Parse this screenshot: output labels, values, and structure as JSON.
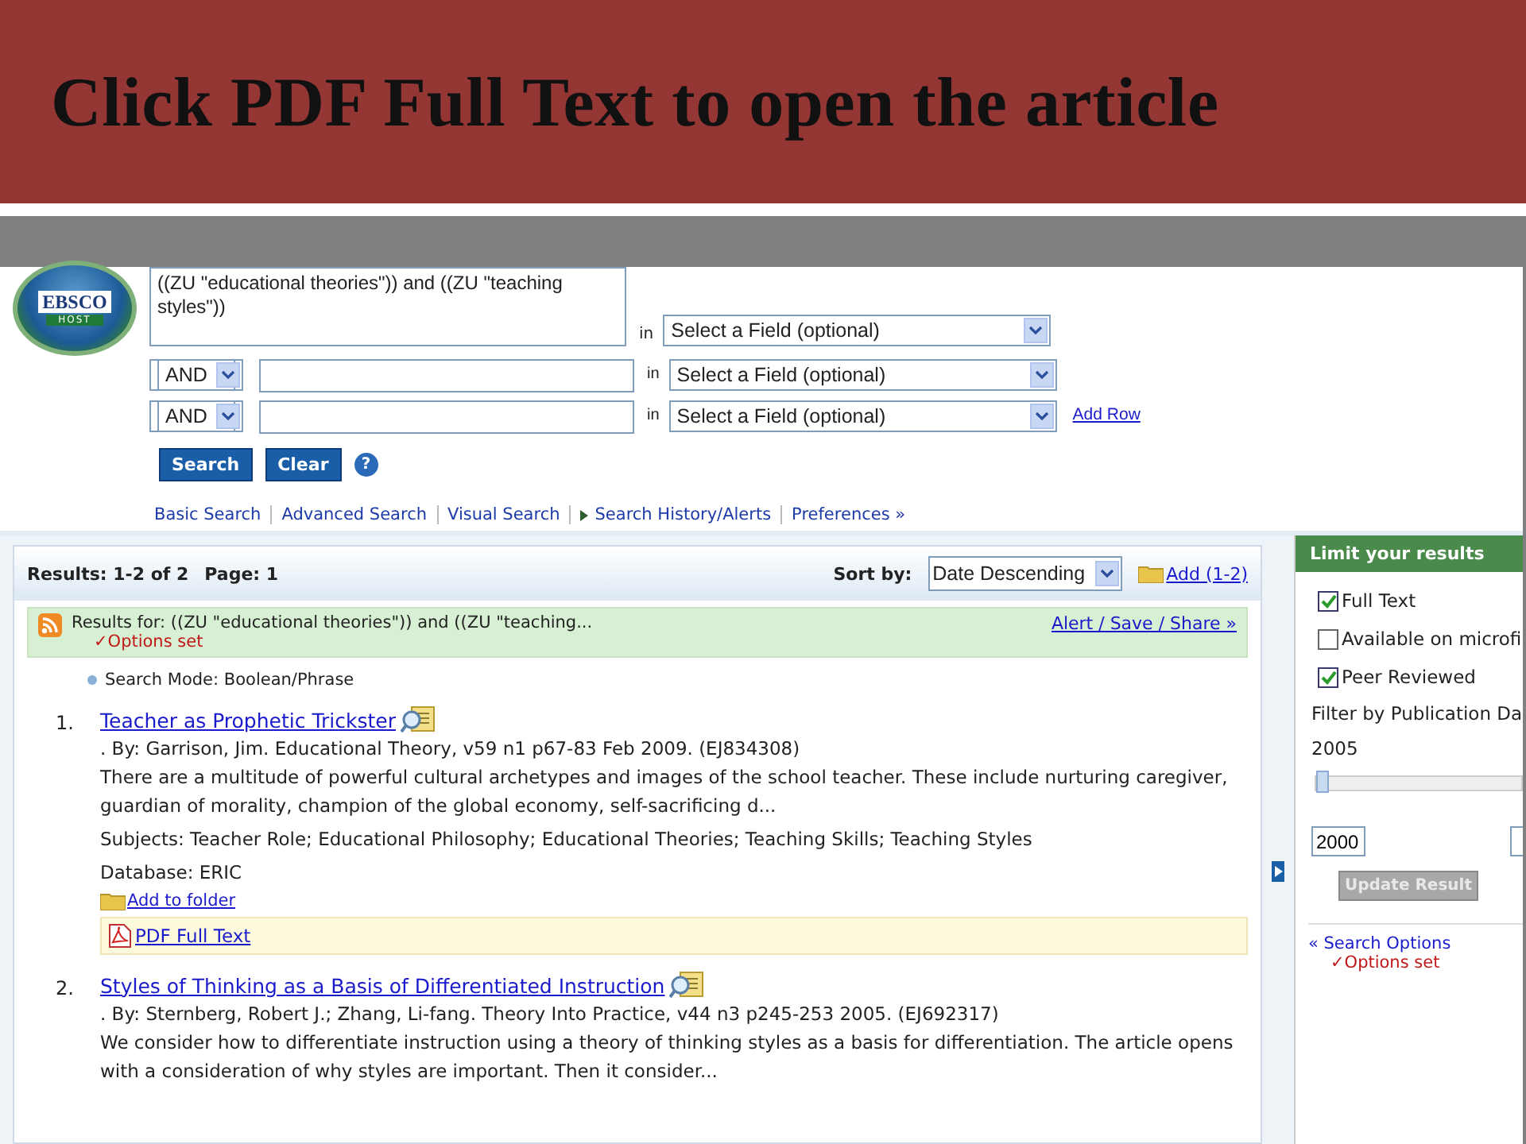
{
  "slide_title": "Click PDF Full Text to open the article",
  "logo": {
    "line_1": "EBSCO",
    "line_2": "HOST"
  },
  "search": {
    "query": "((ZU \"educational theories\"))  and  ((ZU \"teaching styles\"))",
    "rows": [
      {
        "kind": "query",
        "in": "in",
        "field": "Select a Field (optional)"
      },
      {
        "kind": "bool",
        "operator": "AND",
        "value": "",
        "in": "in",
        "field": "Select a Field (optional)"
      },
      {
        "kind": "bool",
        "operator": "AND",
        "value": "",
        "in": "in",
        "field": "Select a Field (optional)",
        "add_row": "Add Row"
      }
    ],
    "buttons": [
      "Search",
      "Clear"
    ],
    "help": "?",
    "links": [
      {
        "label": "Basic Search",
        "kind": "plain"
      },
      {
        "label": "Advanced Search",
        "kind": "plain"
      },
      {
        "label": "Visual Search",
        "kind": "plain"
      },
      {
        "label": "Search History/Alerts",
        "kind": "arrow"
      },
      {
        "label": "Preferences »",
        "kind": "plain"
      }
    ]
  },
  "results": {
    "summary": "Results: 1-2 of 2",
    "page": "Page: 1",
    "sort_label": "Sort by:",
    "sort_value": "Date Descending",
    "add": "Add (1-2)",
    "results_for": "Results for: ((ZU \"educational theories\")) and ((ZU \"teaching...",
    "options_set": "✓Options set",
    "alert": "Alert / Save / Share »",
    "search_mode": "Search Mode: Boolean/Phrase",
    "items": [
      {
        "number": "1.",
        "title": "Teacher as Prophetic Trickster",
        "byline": ". By: Garrison, Jim. Educational Theory, v59 n1 p67-83 Feb 2009. (EJ834308)",
        "abstract": "There are a multitude of powerful cultural archetypes and images of the school teacher. These include nurturing caregiver, guardian of morality, champion of the global economy, self-sacrificing d...",
        "subjects": "Subjects: Teacher Role; Educational Philosophy; Educational Theories; Teaching Skills; Teaching Styles",
        "database": "Database: ERIC",
        "folder": "Add to folder",
        "pdf": "PDF Full Text"
      },
      {
        "number": "2.",
        "title": "Styles of Thinking as a Basis of Differentiated Instruction",
        "byline": ". By: Sternberg, Robert J.; Zhang, Li-fang. Theory Into Practice, v44 n3 p245-253 2005. (EJ692317)",
        "abstract": "We consider how to differentiate instruction using a theory of thinking styles as a basis for differentiation. The article opens with a consideration of why styles are important. Then it consider..."
      }
    ]
  },
  "sidebar": {
    "heading": "Limit your results",
    "checkboxes": [
      {
        "label": "Full Text",
        "checked": true
      },
      {
        "label": "Available on microfi",
        "checked": false
      },
      {
        "label": "Peer Reviewed",
        "checked": true
      }
    ],
    "filter_label": "Filter by Publication Da",
    "year": "2005",
    "slider": {
      "level": 0
    },
    "from": "2000",
    "update": {
      "label": "Update Result",
      "disabled": true
    },
    "search_options": "« Search Options",
    "options_set": "✓Options set"
  }
}
